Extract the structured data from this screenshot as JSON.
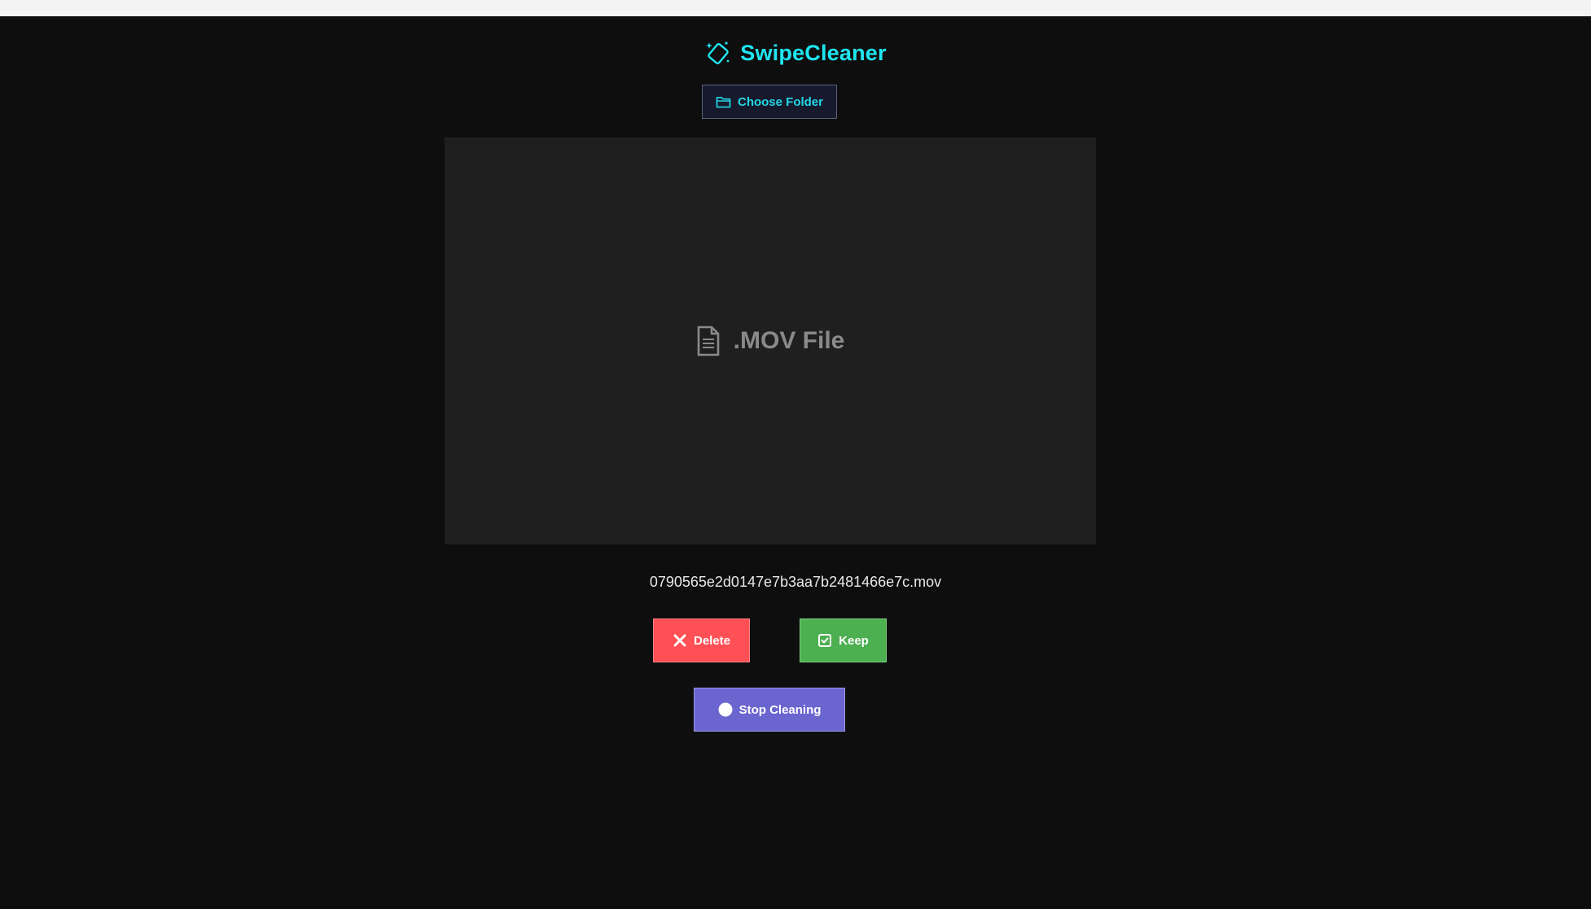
{
  "app": {
    "title": "SwipeCleaner",
    "logo_icon": "sparkle-tablet-icon",
    "accent_color": "#1ee6f0"
  },
  "toolbar": {
    "choose_folder_label": "Choose Folder",
    "choose_folder_icon": "folder-icon"
  },
  "preview": {
    "file_icon": "file-document-icon",
    "label": ".MOV File"
  },
  "file": {
    "name": "0790565e2d0147e7b3aa7b2481466e7c.mov"
  },
  "actions": {
    "delete_label": "Delete",
    "delete_icon": "x-icon",
    "delete_color": "#ff5055",
    "keep_label": "Keep",
    "keep_icon": "checkbox-icon",
    "keep_color": "#4caf50",
    "stop_label": "Stop Cleaning",
    "stop_icon": "stop-circle-icon",
    "stop_color": "#6a65cf"
  }
}
